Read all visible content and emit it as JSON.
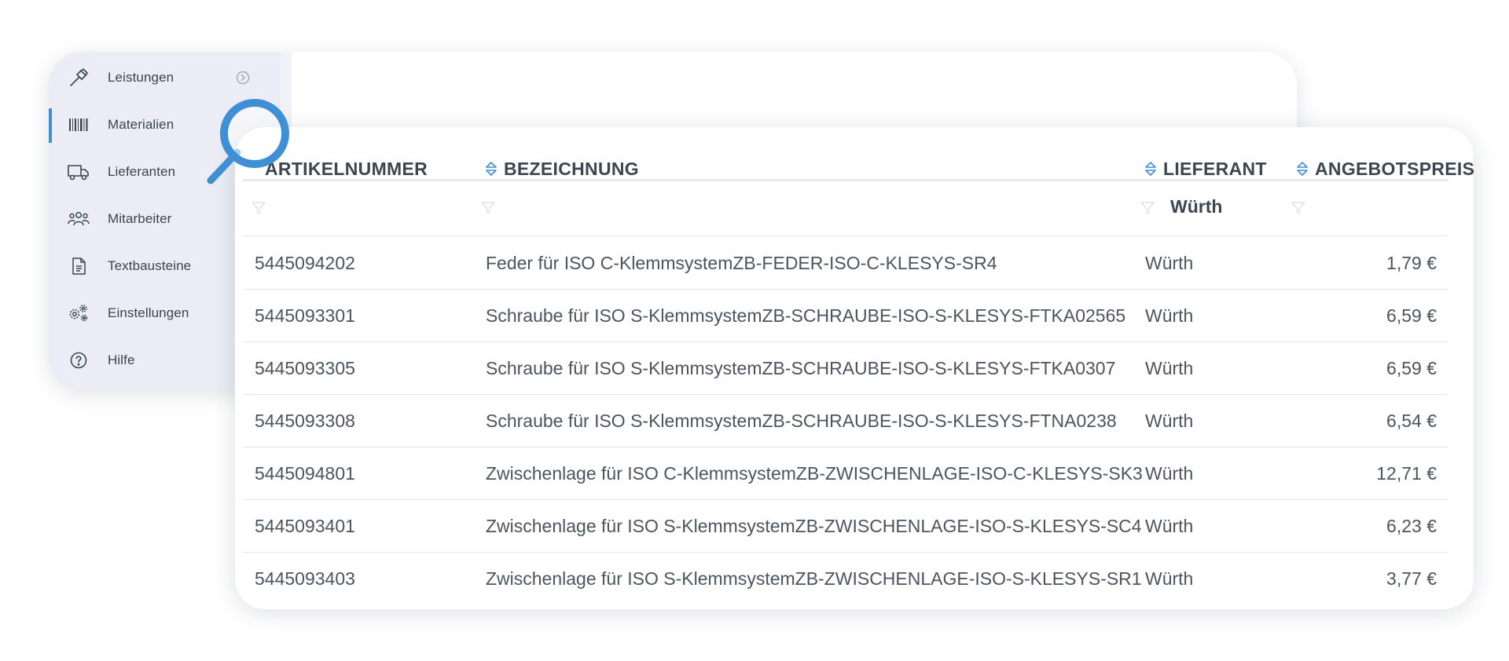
{
  "sidebar": {
    "items": [
      {
        "label": "Leistungen",
        "icon": "hammer-icon"
      },
      {
        "label": "Materialien",
        "icon": "barcode-icon"
      },
      {
        "label": "Lieferanten",
        "icon": "truck-icon"
      },
      {
        "label": "Mitarbeiter",
        "icon": "team-icon"
      },
      {
        "label": "Textbausteine",
        "icon": "document-icon"
      },
      {
        "label": "Einstellungen",
        "icon": "gears-icon"
      },
      {
        "label": "Hilfe",
        "icon": "help-icon"
      }
    ],
    "active_index": 1
  },
  "table": {
    "columns": [
      {
        "label": "ARTIKELNUMMER"
      },
      {
        "label": "BEZEICHNUNG"
      },
      {
        "label": "LIEFERANT"
      },
      {
        "label": "ANGEBOTSPREIS"
      }
    ],
    "filters": {
      "lieferant": "Würth"
    },
    "rows": [
      {
        "artikelnummer": "5445094202",
        "bezeichnung": "Feder für ISO C-KlemmsystemZB-FEDER-ISO-C-KLESYS-SR4",
        "lieferant": "Würth",
        "preis": "1,79 €"
      },
      {
        "artikelnummer": "5445093301",
        "bezeichnung": "Schraube für ISO S-KlemmsystemZB-SCHRAUBE-ISO-S-KLESYS-FTKA02565",
        "lieferant": "Würth",
        "preis": "6,59 €"
      },
      {
        "artikelnummer": "5445093305",
        "bezeichnung": "Schraube für ISO S-KlemmsystemZB-SCHRAUBE-ISO-S-KLESYS-FTKA0307",
        "lieferant": "Würth",
        "preis": "6,59 €"
      },
      {
        "artikelnummer": "5445093308",
        "bezeichnung": "Schraube für ISO S-KlemmsystemZB-SCHRAUBE-ISO-S-KLESYS-FTNA0238",
        "lieferant": "Würth",
        "preis": "6,54 €"
      },
      {
        "artikelnummer": "5445094801",
        "bezeichnung": "Zwischenlage für ISO C-KlemmsystemZB-ZWISCHENLAGE-ISO-C-KLESYS-SK3",
        "lieferant": "Würth",
        "preis": "12,71 €"
      },
      {
        "artikelnummer": "5445093401",
        "bezeichnung": "Zwischenlage für ISO S-KlemmsystemZB-ZWISCHENLAGE-ISO-S-KLESYS-SC4",
        "lieferant": "Würth",
        "preis": "6,23 €"
      },
      {
        "artikelnummer": "5445093403",
        "bezeichnung": "Zwischenlage für ISO S-KlemmsystemZB-ZWISCHENLAGE-ISO-S-KLESYS-SR1",
        "lieferant": "Würth",
        "preis": "3,77 €"
      }
    ]
  },
  "colors": {
    "accent": "#3e8fd4",
    "sidebar_bg": "#ebecf5",
    "text": "#4a5560"
  }
}
